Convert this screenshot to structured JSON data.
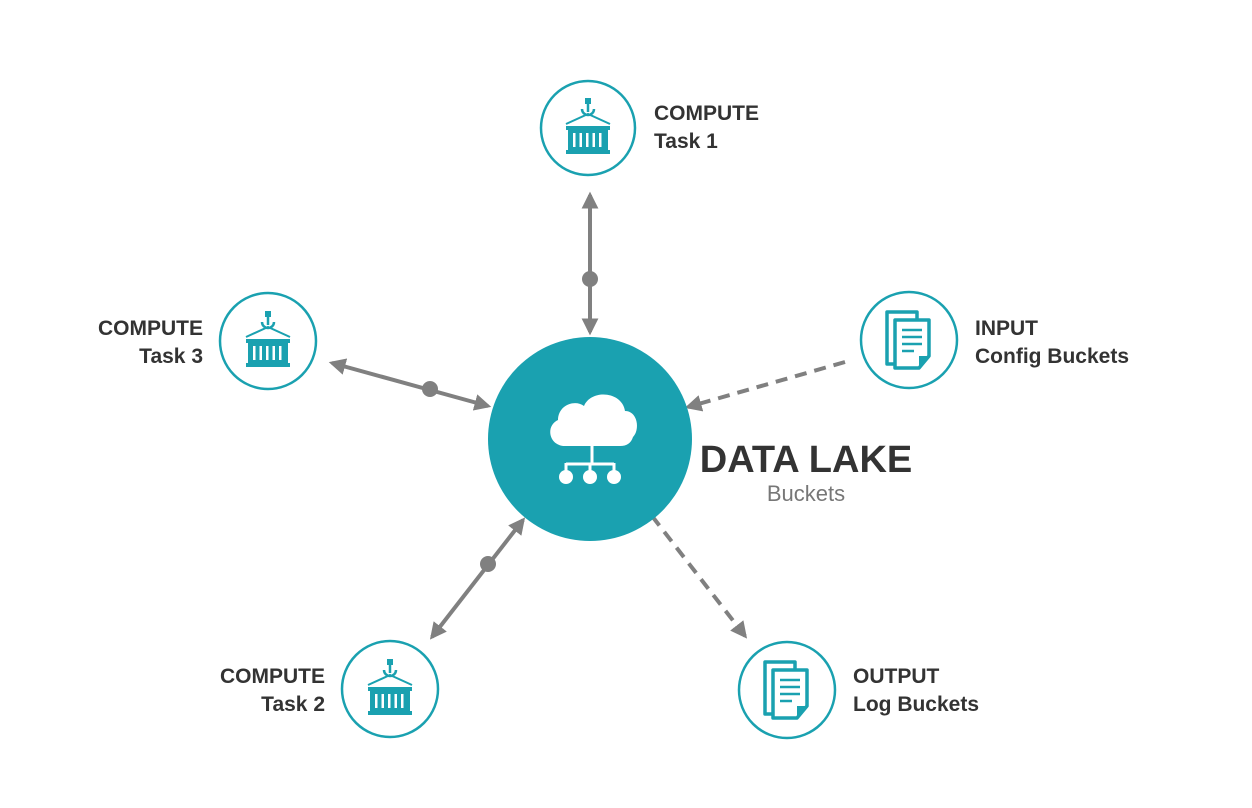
{
  "colors": {
    "accent": "#1aa1b0",
    "connector": "#808080",
    "text": "#333333",
    "muted": "#777777",
    "background": "#ffffff"
  },
  "hub": {
    "title": "DATA LAKE",
    "subtitle": "Buckets",
    "icon": "cloud-network-icon"
  },
  "nodes": {
    "compute_task_1": {
      "line1": "COMPUTE",
      "line2": "Task 1",
      "icon": "shipping-container-icon",
      "connection": "bidirectional-solid"
    },
    "compute_task_2": {
      "line1": "COMPUTE",
      "line2": "Task 2",
      "icon": "shipping-container-icon",
      "connection": "bidirectional-solid"
    },
    "compute_task_3": {
      "line1": "COMPUTE",
      "line2": "Task 3",
      "icon": "shipping-container-icon",
      "connection": "bidirectional-solid"
    },
    "input": {
      "line1": "INPUT",
      "line2": "Config Buckets",
      "icon": "documents-icon",
      "connection": "dashed-into-hub"
    },
    "output": {
      "line1": "OUTPUT",
      "line2": "Log Buckets",
      "icon": "documents-icon",
      "connection": "dashed-out-of-hub"
    }
  }
}
